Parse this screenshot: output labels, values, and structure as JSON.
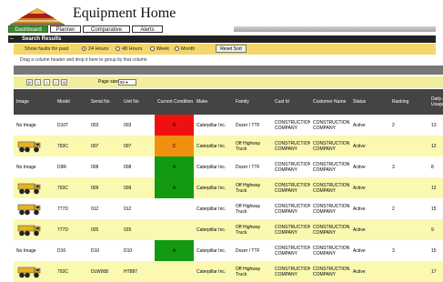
{
  "app": {
    "title": "Equipment Home"
  },
  "tabs": [
    {
      "label": "Dashboard",
      "active": true
    },
    {
      "label": "Planner",
      "active": false
    },
    {
      "label": "Comparative",
      "active": false
    },
    {
      "label": "Alerts",
      "active": false
    }
  ],
  "section": {
    "title": "Search Results",
    "collapse_glyph": "–"
  },
  "filter": {
    "label": "Show faults for past",
    "options": [
      {
        "label": "24 Hours",
        "selected": true
      },
      {
        "label": "48 Hours",
        "selected": false
      },
      {
        "label": "Week",
        "selected": false
      },
      {
        "label": "Month",
        "selected": false
      }
    ],
    "reset_label": "Reset Sort"
  },
  "grid": {
    "drag_hint": "Drag a column header and drop it here to group by that column",
    "pager": {
      "first": "|«",
      "prev": "‹",
      "page": "1",
      "next": "›",
      "last": "»|",
      "page_size_label": "Page size:",
      "page_size": "50"
    },
    "columns": [
      "Image",
      "Model",
      "Serial No",
      "Unit No",
      "Current Condition",
      "Make",
      "Family",
      "Cust Id",
      "Customer Name",
      "Status",
      "Ranking",
      "Daily Avg Usage"
    ],
    "rows": [
      {
        "image": "No Image",
        "model": "D10T",
        "serial": "003",
        "unit": "003",
        "condition": "R",
        "cond_color": "#ee1111",
        "make": "Caterpillar Inc.",
        "family": "Dozer / TTF",
        "cust": "CONSTRUCTION COMPANY",
        "customer": "CONSTRUCTION COMPANY",
        "status": "Active",
        "ranking": "2",
        "usage": "13"
      },
      {
        "image": "truck",
        "model": "793C",
        "serial": "007",
        "unit": "007",
        "condition": "C",
        "cond_color": "#f09010",
        "make": "Caterpillar Inc.",
        "family": "Off Highway Truck",
        "cust": "CONSTRUCTION COMPANY",
        "customer": "CONSTRUCTION COMPANY",
        "status": "Active",
        "ranking": "",
        "usage": "12"
      },
      {
        "image": "No Image",
        "model": "D9R",
        "serial": "008",
        "unit": "008",
        "condition": "A",
        "cond_color": "#129a12",
        "make": "Caterpillar Inc.",
        "family": "Dozer / TTF",
        "cust": "CONSTRUCTION COMPANY",
        "customer": "CONSTRUCTION COMPANY",
        "status": "Active",
        "ranking": "3",
        "usage": "8"
      },
      {
        "image": "truck",
        "model": "793C",
        "serial": "009",
        "unit": "009",
        "condition": "A",
        "cond_color": "#129a12",
        "make": "Caterpillar Inc.",
        "family": "Off Highway Truck",
        "cust": "CONSTRUCTION COMPANY",
        "customer": "CONSTRUCTION COMPANY",
        "status": "Active",
        "ranking": "",
        "usage": "12"
      },
      {
        "image": "truck",
        "model": "777D",
        "serial": "012",
        "unit": "012",
        "condition": "",
        "cond_color": "",
        "make": "Caterpillar Inc.",
        "family": "Off Highway Truck",
        "cust": "CONSTRUCTION COMPANY",
        "customer": "CONSTRUCTION COMPANY",
        "status": "Active",
        "ranking": "2",
        "usage": "15"
      },
      {
        "image": "truck",
        "model": "777D",
        "serial": "025",
        "unit": "025",
        "condition": "",
        "cond_color": "",
        "make": "Caterpillar Inc.",
        "family": "Off Highway Truck",
        "cust": "CONSTRUCTION COMPANY",
        "customer": "CONSTRUCTION COMPANY",
        "status": "Active",
        "ranking": "",
        "usage": "9"
      },
      {
        "image": "No Image",
        "model": "D10",
        "serial": "D10",
        "unit": "D10",
        "condition": "A",
        "cond_color": "#129a12",
        "make": "Caterpillar Inc.",
        "family": "Dozer / TTF",
        "cust": "CONSTRUCTION COMPANY",
        "customer": "CONSTRUCTION COMPANY",
        "status": "Active",
        "ranking": "3",
        "usage": "15"
      },
      {
        "image": "truck",
        "model": "793C",
        "serial": "DLW008",
        "unit": "HT887",
        "condition": "",
        "cond_color": "",
        "make": "Caterpillar Inc.",
        "family": "Off Highway Truck",
        "cust": "CONSTRUCTION COMPANY",
        "customer": "CONSTRUCTION COMPANY",
        "status": "Active",
        "ranking": "",
        "usage": "17"
      }
    ]
  },
  "colors": {
    "header_bg": "#444444",
    "row_alt": "#fbf8b0",
    "row_normal": "#ffffff",
    "filter_bg": "#f4d76a",
    "active_tab": "#3a8a2e"
  }
}
